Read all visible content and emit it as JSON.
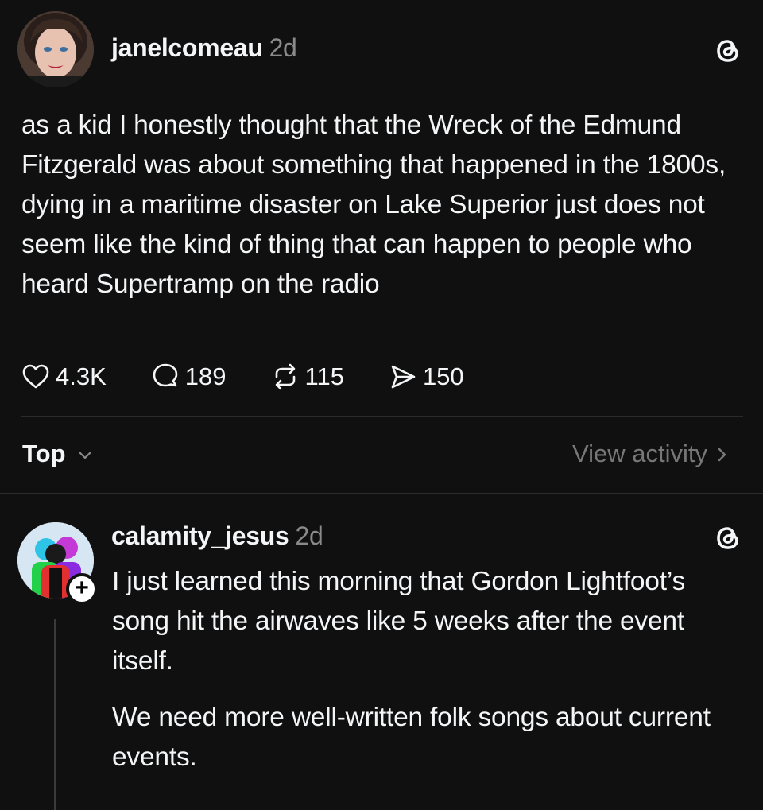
{
  "post": {
    "username": "janelcomeau",
    "time": "2d",
    "text": "as a kid I honestly thought that the Wreck of the Edmund Fitzgerald was about something that happened in the 1800s, dying in a maritime disaster on Lake Superior just does not seem like the kind of thing that can happen to people who heard Supertramp on the radio",
    "stats": {
      "likes": "4.3K",
      "replies": "189",
      "reposts": "115",
      "shares": "150"
    }
  },
  "sort": {
    "label": "Top",
    "view_activity": "View activity"
  },
  "reply": {
    "username": "calamity_jesus",
    "time": "2d",
    "follow_symbol": "+",
    "paragraph1": "I just learned this morning that Gordon Lightfoot’s song hit the airwaves like 5 weeks after the event itself.",
    "paragraph2": "We need more well-written folk songs about current events."
  },
  "colors": {
    "background": "#101010",
    "text": "#f3f5f7",
    "muted": "#8a8a8a",
    "divider": "#2a2a2a"
  }
}
